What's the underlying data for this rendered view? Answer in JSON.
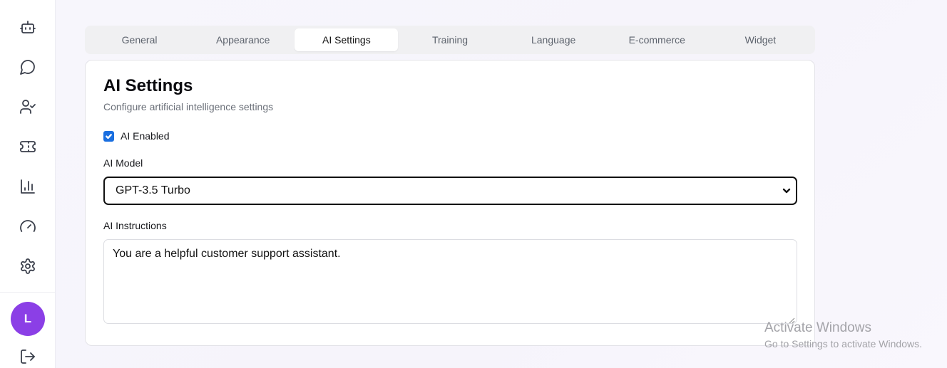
{
  "sidebar": {
    "items": [
      {
        "icon": "bot-icon",
        "name": "sidebar-item-bots"
      },
      {
        "icon": "chat-icon",
        "name": "sidebar-item-conversations"
      },
      {
        "icon": "user-check-icon",
        "name": "sidebar-item-agents"
      },
      {
        "icon": "ticket-icon",
        "name": "sidebar-item-tickets"
      },
      {
        "icon": "bar-chart-icon",
        "name": "sidebar-item-analytics"
      },
      {
        "icon": "gauge-icon",
        "name": "sidebar-item-performance"
      },
      {
        "icon": "gear-icon",
        "name": "sidebar-item-settings"
      }
    ],
    "avatar_initial": "L",
    "avatar_color": "#8b3fe6",
    "logout_icon": "logout-icon"
  },
  "tabs": [
    {
      "label": "General"
    },
    {
      "label": "Appearance"
    },
    {
      "label": "AI Settings"
    },
    {
      "label": "Training"
    },
    {
      "label": "Language"
    },
    {
      "label": "E-commerce"
    },
    {
      "label": "Widget"
    }
  ],
  "active_tab": "AI Settings",
  "card": {
    "title": "AI Settings",
    "subtitle": "Configure artificial intelligence settings",
    "ai_enabled_label": "AI Enabled",
    "ai_enabled": true,
    "model_label": "AI Model",
    "model_value": "GPT-3.5 Turbo",
    "instructions_label": "AI Instructions",
    "instructions_value": "You are a helpful customer support assistant."
  },
  "watermark": {
    "title": "Activate Windows",
    "subtitle": "Go to Settings to activate Windows."
  },
  "colors": {
    "accent": "#1a6fe0",
    "avatar": "#8b3fe6"
  }
}
